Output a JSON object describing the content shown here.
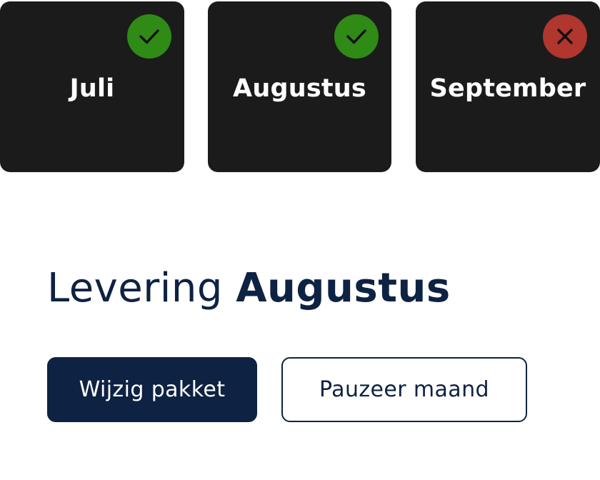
{
  "months": [
    {
      "label": "Juli",
      "status": "delivered",
      "status_icon": "check-icon",
      "badge_color": "#2f8a16"
    },
    {
      "label": "Augustus",
      "status": "delivered",
      "status_icon": "check-icon",
      "badge_color": "#2f8a16"
    },
    {
      "label": "September",
      "status": "paused",
      "status_icon": "close-icon",
      "badge_color": "#b0362e"
    }
  ],
  "delivery": {
    "prefix": "Levering",
    "month": "Augustus"
  },
  "actions": {
    "change_package": "Wijzig pakket",
    "pause_month": "Pauzeer maand"
  },
  "colors": {
    "card_bg": "#1b1b1b",
    "primary": "#0e2243",
    "success": "#2f8a16",
    "danger": "#b0362e"
  }
}
